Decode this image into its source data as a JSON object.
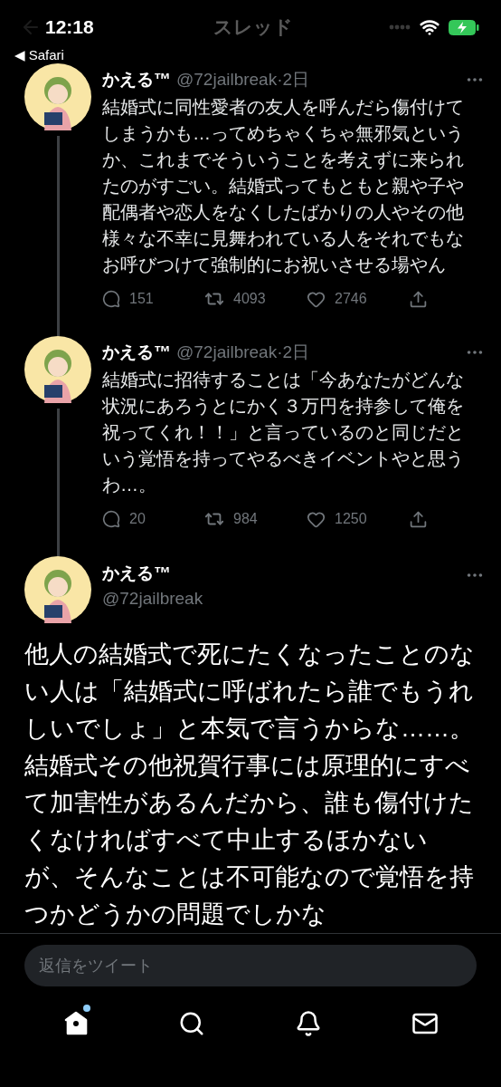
{
  "status_bar": {
    "time": "12:18",
    "back_app": "◀ Safari"
  },
  "nav": {
    "title": "スレッド"
  },
  "tweets": [
    {
      "name": "かえる™",
      "meta": "@72jailbreak·2日",
      "text": "結婚式に同性愛者の友人を呼んだら傷付けてしまうかも…ってめちゃくちゃ無邪気というか、これまでそういうことを考えずに来られたのがすごい。結婚式ってもともと親や子や配偶者や恋人をなくしたばかりの人やその他様々な不幸に見舞われている人をそれでもなお呼びつけて強制的にお祝いさせる場やん",
      "replies": "151",
      "retweets": "4093",
      "likes": "2746"
    },
    {
      "name": "かえる™",
      "meta": "@72jailbreak·2日",
      "text": "結婚式に招待することは「今あなたがどんな状況にあろうとにかく３万円を持参して俺を祝ってくれ！！」と言っているのと同じだという覚悟を持ってやるべきイベントやと思うわ…。",
      "replies": "20",
      "retweets": "984",
      "likes": "1250"
    }
  ],
  "main_tweet": {
    "name": "かえる™",
    "handle": "@72jailbreak",
    "text": "他人の結婚式で死にたくなったことのない人は「結婚式に呼ばれたら誰でもうれしいでしょ」と本気で言うからな……。結婚式その他祝賀行事には原理的にすべて加害性があるんだから、誰も傷付けたくなければすべて中止するほかないが、そんなことは不可能なので覚悟を持つかどうかの問題でしかな"
  },
  "reply_field": {
    "placeholder": "返信をツイート"
  },
  "tab_bar": {
    "items": [
      {
        "kind": "home",
        "selected": true,
        "badge": true
      },
      {
        "kind": "search",
        "selected": false,
        "badge": false
      },
      {
        "kind": "notifications",
        "selected": false,
        "badge": false
      },
      {
        "kind": "messages",
        "selected": false,
        "badge": false
      }
    ]
  }
}
